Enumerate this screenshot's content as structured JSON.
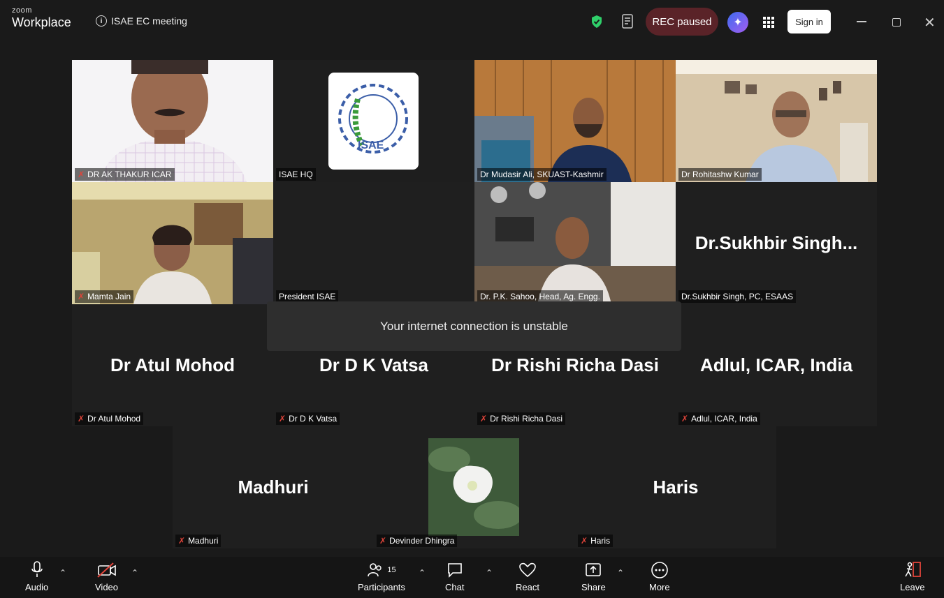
{
  "app": {
    "brand_small": "zoom",
    "brand_large": "Workplace",
    "meeting_title": "ISAE EC meeting"
  },
  "header": {
    "rec_label": "REC paused",
    "signin_label": "Sign in"
  },
  "notice": "Your internet connection is unstable",
  "tiles": {
    "ak_thakur": "DR AK THAKUR ICAR",
    "isae_hq": "ISAE HQ",
    "logo_text": "ISAE",
    "mudasir": "Dr Mudasir Ali, SKUAST-Kashmir",
    "rohitashw": "Dr Rohitashw Kumar",
    "mamta": "Mamta Jain",
    "president": "President ISAE",
    "sahoo": "Dr. P.K. Sahoo, Head, Ag. Engg.",
    "sukhbir_big": "Dr.Sukhbir  Singh...",
    "sukhbir": "Dr.Sukhbir Singh, PC, ESAAS",
    "atul_big": "Dr Atul Mohod",
    "atul": "Dr Atul Mohod",
    "vatsa_big": "Dr D K Vatsa",
    "vatsa": "Dr D K Vatsa",
    "rishi_big": "Dr Rishi Richa Dasi",
    "rishi": "Dr Rishi Richa Dasi",
    "adlul_big": "Adlul, ICAR, India",
    "adlul": "Adlul, ICAR, India",
    "madhuri_big": "Madhuri",
    "madhuri": "Madhuri",
    "devinder": "Devinder Dhingra",
    "haris_big": "Haris",
    "haris": "Haris"
  },
  "toolbar": {
    "audio": "Audio",
    "video": "Video",
    "participants": "Participants",
    "participants_count": "15",
    "chat": "Chat",
    "react": "React",
    "share": "Share",
    "more": "More",
    "leave": "Leave"
  },
  "colors": {
    "active_speaker": "#2fd06a",
    "muted": "#e0443a",
    "rec_bg": "#5a2328"
  }
}
